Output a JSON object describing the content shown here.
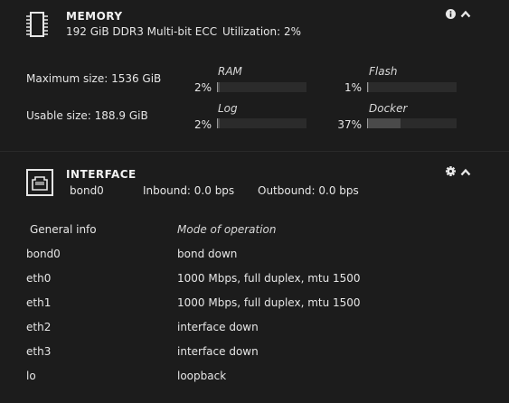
{
  "memory": {
    "title": "MEMORY",
    "description": "192 GiB DDR3 Multi-bit ECC",
    "utilization": "Utilization: 2%",
    "max_size": "Maximum size: 1536 GiB",
    "usable_size": "Usable size: 188.9 GiB",
    "usage": [
      {
        "label": "RAM",
        "percent_text": "2%",
        "percent": 2
      },
      {
        "label": "Flash",
        "percent_text": "1%",
        "percent": 1
      },
      {
        "label": "Log",
        "percent_text": "2%",
        "percent": 2
      },
      {
        "label": "Docker",
        "percent_text": "37%",
        "percent": 37
      }
    ]
  },
  "interface": {
    "title": "INTERFACE",
    "name": "bond0",
    "inbound": "Inbound: 0.0 bps",
    "outbound": "Outbound: 0.0 bps",
    "table": {
      "col1": "General info",
      "col2": "Mode of operation",
      "rows": [
        {
          "name": "bond0",
          "mode": "bond down"
        },
        {
          "name": "eth0",
          "mode": "1000 Mbps, full duplex, mtu 1500"
        },
        {
          "name": "eth1",
          "mode": "1000 Mbps, full duplex, mtu 1500"
        },
        {
          "name": "eth2",
          "mode": "interface down"
        },
        {
          "name": "eth3",
          "mode": "interface down"
        },
        {
          "name": "lo",
          "mode": "loopback"
        }
      ]
    }
  },
  "icons": {
    "info": "info-icon",
    "collapse": "chevron-up-icon",
    "settings": "gear-icon",
    "memory": "memory-chip-icon",
    "ethernet": "ethernet-port-icon"
  }
}
